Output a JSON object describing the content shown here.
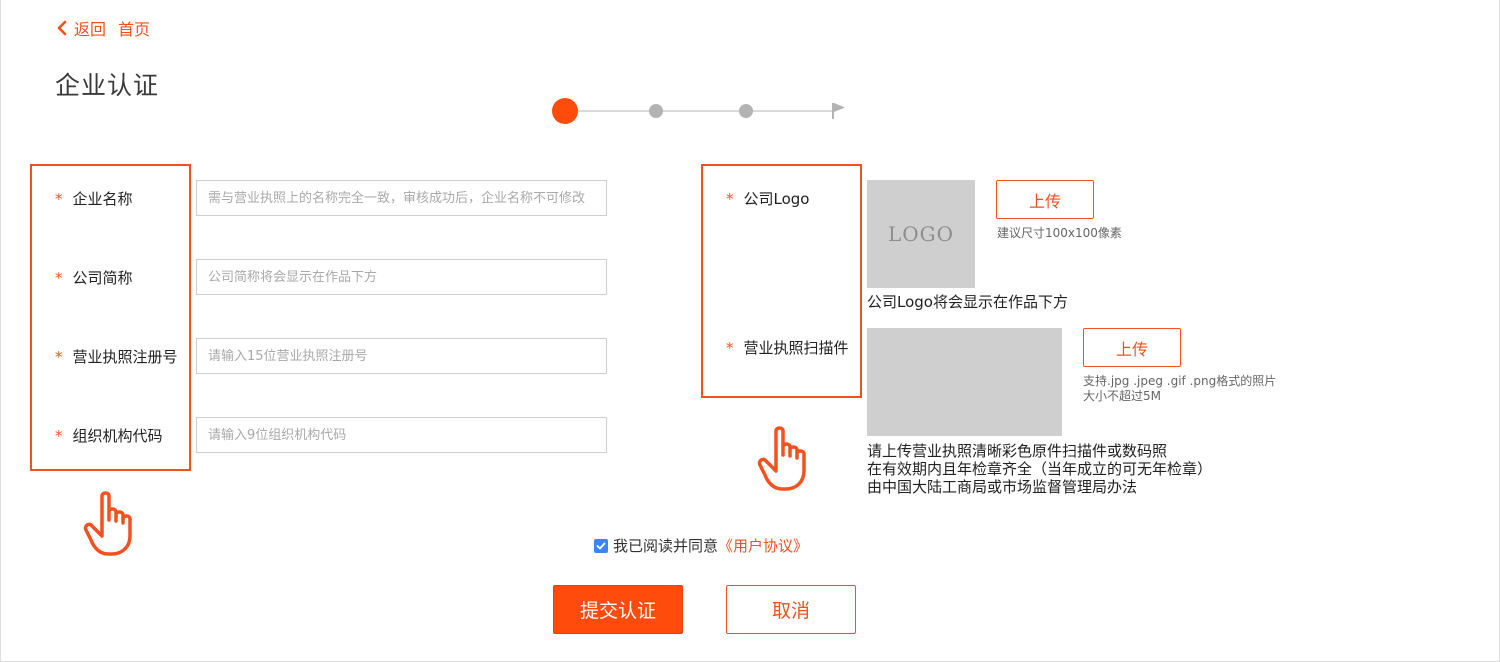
{
  "header": {
    "back_label": "返回",
    "home_label": "首页",
    "page_title": "企业认证"
  },
  "stepper": {
    "total_steps": 4,
    "current_step": 1
  },
  "form": {
    "required_mark": "*",
    "fields": [
      {
        "label": "企业名称",
        "placeholder": "需与营业执照上的名称完全一致，审核成功后，企业名称不可修改"
      },
      {
        "label": "公司简称",
        "placeholder": "公司简称将会显示在作品下方"
      },
      {
        "label": "营业执照注册号",
        "placeholder": "请输入15位营业执照注册号"
      },
      {
        "label": "组织机构代码",
        "placeholder": "请输入9位组织机构代码"
      }
    ]
  },
  "uploads": {
    "logo": {
      "label": "公司Logo",
      "preview_text": "LOGO",
      "button": "上传",
      "hint": "建议尺寸100x100像素",
      "desc": "公司Logo将会显示在作品下方"
    },
    "license": {
      "label": "营业执照扫描件",
      "button": "上传",
      "hint_line1": "支持.jpg .jpeg .gif .png格式的照片",
      "hint_line2": "大小不超过5M",
      "desc_line1": "请上传营业执照清晰彩色原件扫描件或数码照",
      "desc_line2": "在有效期内且年检章齐全（当年成立的可无年检章）",
      "desc_line3": "由中国大陆工商局或市场监督管理局办法"
    }
  },
  "agreement": {
    "checked": true,
    "text": "我已阅读并同意",
    "link": "《用户协议》"
  },
  "actions": {
    "submit": "提交认证",
    "cancel": "取消"
  },
  "colors": {
    "accent": "#ff4c0d",
    "annotation": "#f4511e",
    "placeholder_gray": "#cfcfcf",
    "checkbox_blue": "#3b86f2"
  }
}
